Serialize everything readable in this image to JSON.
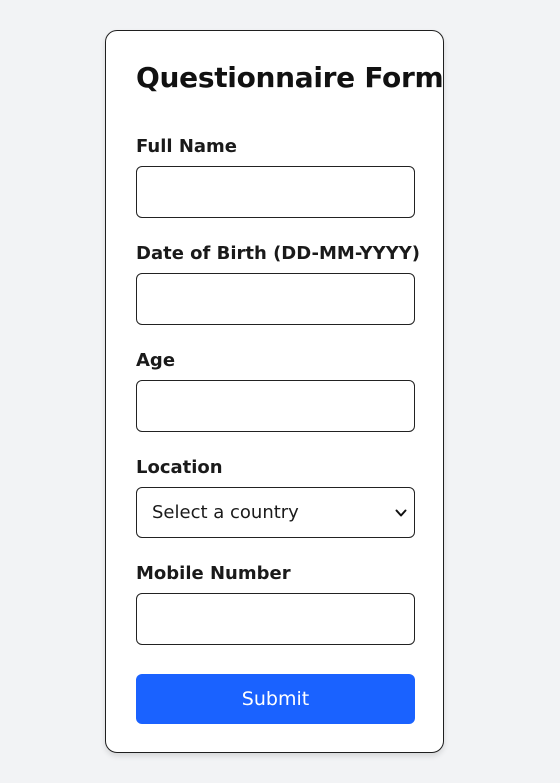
{
  "form": {
    "title": "Questionnaire Form",
    "fields": [
      {
        "label": "Full Name",
        "value": "",
        "placeholder": ""
      },
      {
        "label": "Date of Birth (DD-MM-YYYY)",
        "value": "",
        "placeholder": ""
      },
      {
        "label": "Age",
        "value": "",
        "placeholder": ""
      },
      {
        "label": "Location",
        "selected": "Select a country",
        "icon": "chevron-down-icon"
      },
      {
        "label": "Mobile Number",
        "value": "",
        "placeholder": ""
      }
    ],
    "submit_label": "Submit"
  },
  "colors": {
    "page_background": "#f2f3f5",
    "card_background": "#ffffff",
    "primary_button": "#1a62ff",
    "border": "#222222"
  }
}
